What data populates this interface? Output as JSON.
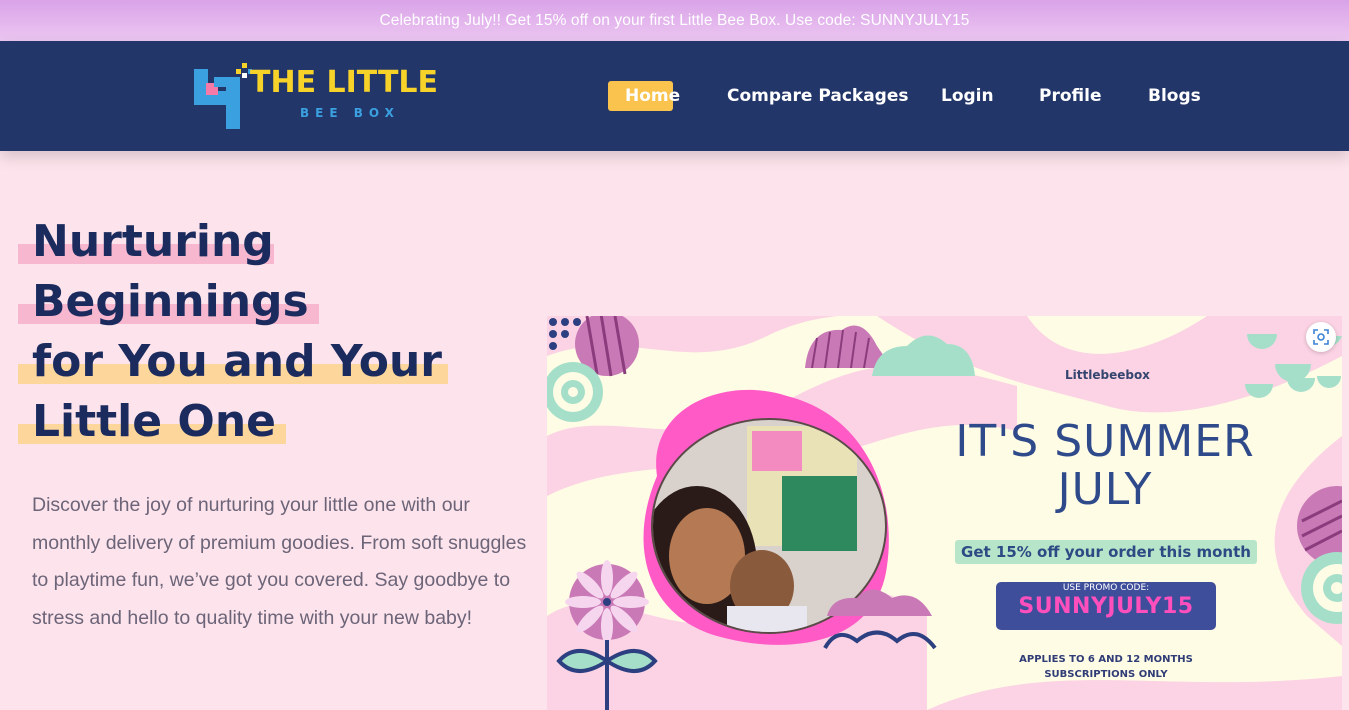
{
  "promo_bar": {
    "text": "Celebrating July!! Get 15% off on your first Little Bee Box. Use code: SUNNYJULY15"
  },
  "logo": {
    "main_text": "THE LITTLE",
    "sub_text": "BEE BOX"
  },
  "nav": {
    "items": [
      {
        "label": "Home",
        "active": true
      },
      {
        "label": "Compare Packages",
        "active": false
      },
      {
        "label": "Login",
        "active": false
      },
      {
        "label": "Profile",
        "active": false
      },
      {
        "label": "Blogs",
        "active": false
      }
    ]
  },
  "hero": {
    "title_lines": [
      "Nurturing",
      "Beginnings",
      "for You and Your",
      "Little One"
    ],
    "description": "Discover the joy of nurturing your little one with our monthly delivery of premium goodies. From soft snuggles to playtime fun, we’ve got you covered. Say goodbye to stress and hello to quality time with your new baby!"
  },
  "banner": {
    "brand": "Littlebeebox",
    "title_line1": "IT'S SUMMER",
    "title_line2": "JULY",
    "offer": "Get 15% off your order this month",
    "code_label": "USE PROMO CODE:",
    "code": "SUNNYJULY15",
    "applies_line1": "APPLIES TO 6 AND 12 MONTHS",
    "applies_line2": "SUBSCRIPTIONS ONLY"
  },
  "colors": {
    "navbar": "#23366a",
    "accent_yellow": "#f9c34e",
    "page_bg": "#fde4ec",
    "title": "#1b2b5e",
    "promo_bar": "#d9a3e8"
  },
  "icons": {
    "visual_search": "scan-icon"
  }
}
